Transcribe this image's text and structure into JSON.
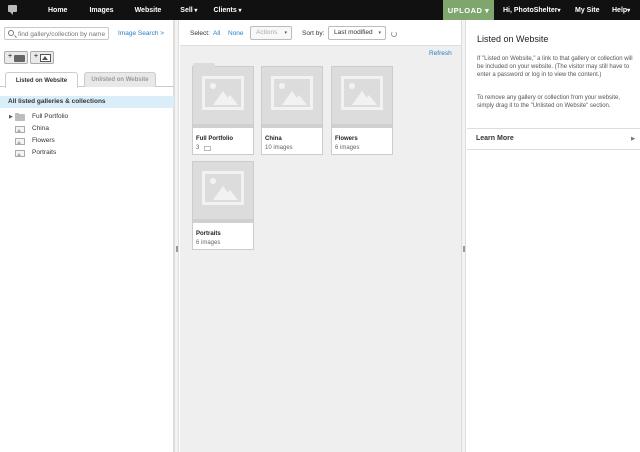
{
  "nav": {
    "home": "Home",
    "images": "Images",
    "website": "Website",
    "sell": "Sell",
    "clients": "Clients",
    "upload": "UPLOAD",
    "greeting": "Hi, PhotoShelter",
    "my_site": "My Site",
    "help": "Help"
  },
  "left": {
    "search_placeholder": "find gallery/collection by name",
    "image_search": "Image Search >",
    "tabs": [
      "Listed on Website",
      "Unlisted on Website"
    ],
    "all_label": "All listed galleries & collections",
    "tree": [
      {
        "label": "Full Portfolio",
        "type": "folder"
      },
      {
        "label": "China",
        "type": "gallery"
      },
      {
        "label": "Flowers",
        "type": "gallery"
      },
      {
        "label": "Portraits",
        "type": "gallery"
      }
    ]
  },
  "toolbar": {
    "select_label": "Select:",
    "all": "All",
    "none": "None",
    "actions": "Actions",
    "sort_label": "Sort by:",
    "sort_value": "Last modified",
    "refresh": "Refresh"
  },
  "cards": [
    {
      "title": "Full Portfolio",
      "sub": "3"
    },
    {
      "title": "China",
      "sub": "10 images"
    },
    {
      "title": "Flowers",
      "sub": "6 images"
    },
    {
      "title": "Portraits",
      "sub": "6 images"
    }
  ],
  "info": {
    "title": "Listed on Website",
    "p1": "If \"Listed on Website,\" a link to that gallery or collection will be included on your website. (The visitor may still have to enter a password or log in to view the content.)",
    "p2": "To remove any gallery or collection from your website, simply drag it to the \"Unlisted on Website\" section.",
    "learn_more": "Learn More"
  },
  "colors": {
    "topbar": "#111111",
    "upload": "#7ea66d",
    "link": "#2a7fc0",
    "selected_row": "#d9eef9"
  }
}
